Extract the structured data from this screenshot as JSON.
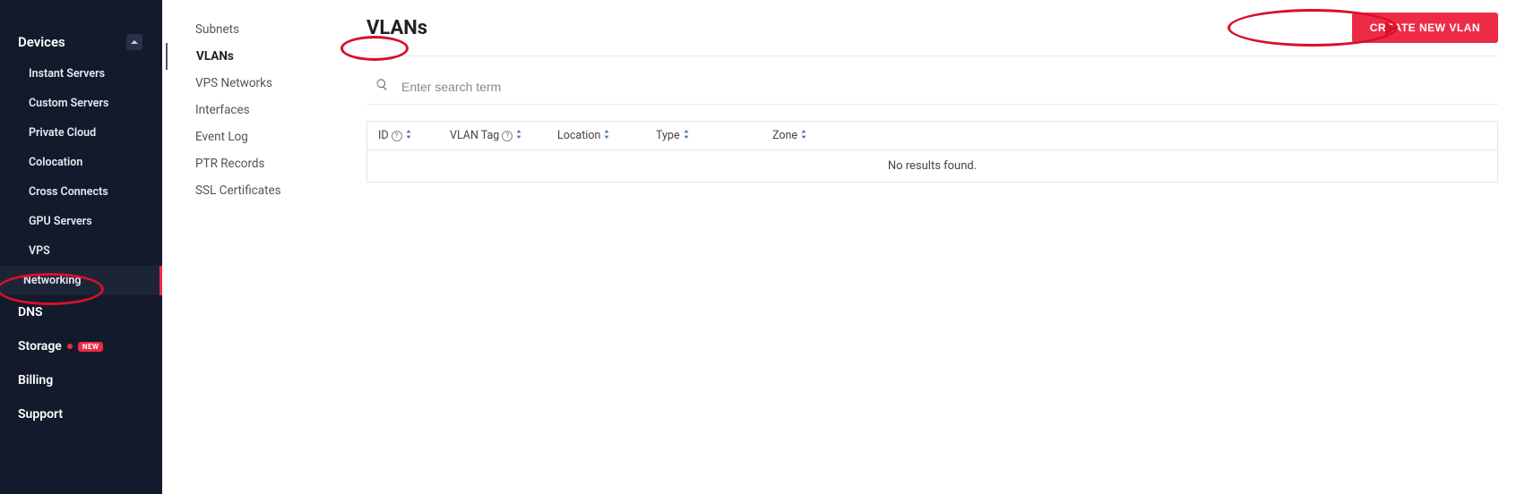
{
  "sidebar": {
    "devices_label": "Devices",
    "subitems": [
      {
        "label": "Instant Servers"
      },
      {
        "label": "Custom Servers"
      },
      {
        "label": "Private Cloud"
      },
      {
        "label": "Colocation"
      },
      {
        "label": "Cross Connects"
      },
      {
        "label": "GPU Servers"
      },
      {
        "label": "VPS"
      },
      {
        "label": "Networking"
      }
    ],
    "top_items": {
      "dns": "DNS",
      "storage": "Storage",
      "storage_badge": "NEW",
      "billing": "Billing",
      "support": "Support"
    }
  },
  "subnav": {
    "items": [
      {
        "label": "Subnets"
      },
      {
        "label": "VLANs"
      },
      {
        "label": "VPS Networks"
      },
      {
        "label": "Interfaces"
      },
      {
        "label": "Event Log"
      },
      {
        "label": "PTR Records"
      },
      {
        "label": "SSL Certificates"
      }
    ]
  },
  "main": {
    "title": "VLANs",
    "create_label": "CREATE NEW VLAN",
    "search_placeholder": "Enter search term",
    "columns": {
      "id": "ID",
      "tag": "VLAN Tag",
      "location": "Location",
      "type": "Type",
      "zone": "Zone"
    },
    "empty": "No results found."
  }
}
